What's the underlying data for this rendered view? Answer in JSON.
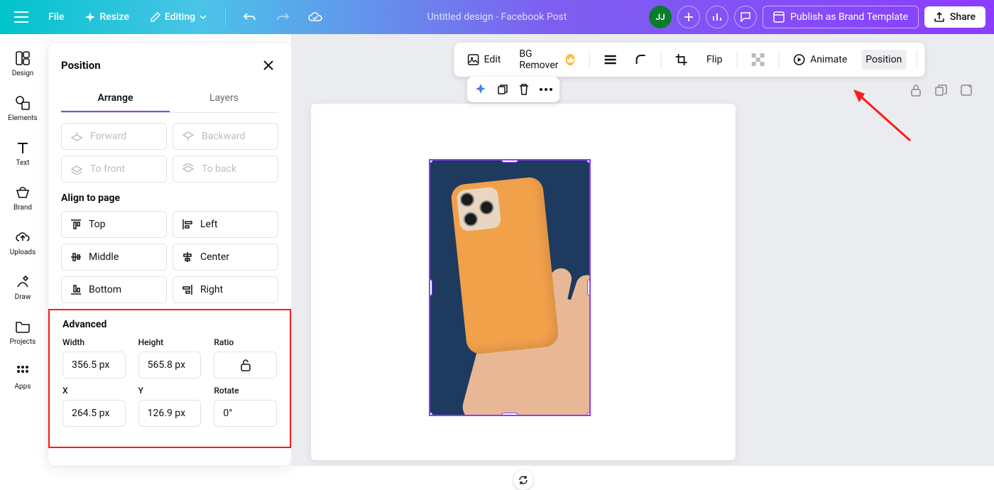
{
  "topbar": {
    "file": "File",
    "resize": "Resize",
    "editing": "Editing",
    "title": "Untitled design - Facebook Post",
    "avatar_initials": "JJ",
    "publish": "Publish as Brand Template",
    "share": "Share"
  },
  "leftrail": {
    "items": [
      {
        "label": "Design",
        "icon": "layout-icon"
      },
      {
        "label": "Elements",
        "icon": "shapes-icon"
      },
      {
        "label": "Text",
        "icon": "text-icon"
      },
      {
        "label": "Brand",
        "icon": "brand-icon"
      },
      {
        "label": "Uploads",
        "icon": "cloud-upload-icon"
      },
      {
        "label": "Draw",
        "icon": "pencil-icon"
      },
      {
        "label": "Projects",
        "icon": "folder-icon"
      },
      {
        "label": "Apps",
        "icon": "grid-icon"
      }
    ]
  },
  "position_panel": {
    "title": "Position",
    "tabs": {
      "arrange": "Arrange",
      "layers": "Layers"
    },
    "layer_buttons": {
      "forward": "Forward",
      "backward": "Backward",
      "to_front": "To front",
      "to_back": "To back"
    },
    "align_header": "Align to page",
    "align_buttons": {
      "top": "Top",
      "left": "Left",
      "middle": "Middle",
      "center": "Center",
      "bottom": "Bottom",
      "right": "Right"
    },
    "advanced_header": "Advanced",
    "advanced": {
      "width_label": "Width",
      "width_value": "356.5 px",
      "height_label": "Height",
      "height_value": "565.8 px",
      "ratio_label": "Ratio",
      "x_label": "X",
      "x_value": "264.5 px",
      "y_label": "Y",
      "y_value": "126.9 px",
      "rotate_label": "Rotate",
      "rotate_value": "0°"
    }
  },
  "context_toolbar": {
    "edit": "Edit",
    "bg_remover": "BG Remover",
    "flip": "Flip",
    "animate": "Animate",
    "position": "Position"
  }
}
